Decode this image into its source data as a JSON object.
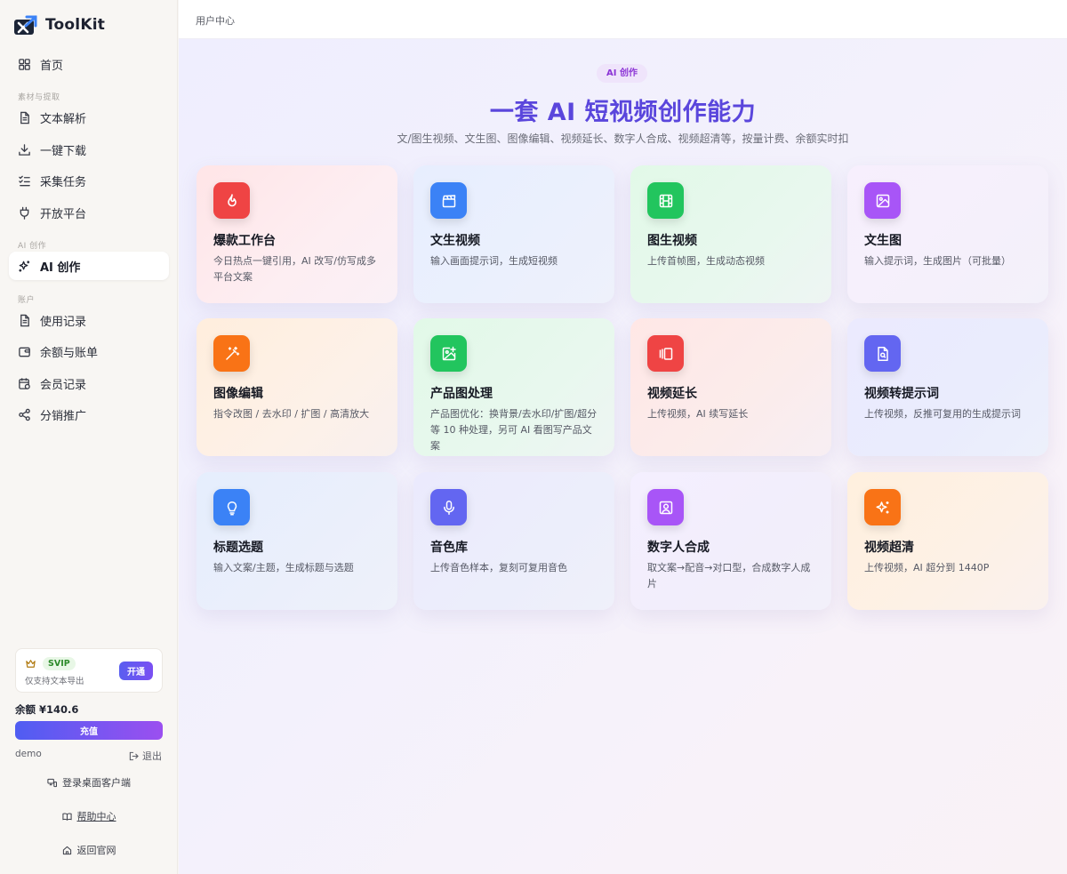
{
  "brand": {
    "name": "ToolKit"
  },
  "nav": {
    "home": "首页",
    "section_material": "素材与提取",
    "text_parse": "文本解析",
    "download": "一键下载",
    "collect": "采集任务",
    "open_platform": "开放平台",
    "section_ai": "AI 创作",
    "ai_create": "AI 创作",
    "section_account": "账户",
    "usage": "使用记录",
    "balance_bill": "余额与账单",
    "member": "会员记录",
    "affiliate": "分销推广"
  },
  "vip": {
    "badge": "SVIP",
    "desc": "仅支持文本导出",
    "button": "开通"
  },
  "account": {
    "balance": "余额 ¥140.6",
    "recharge": "充值",
    "username": "demo",
    "logout": "退出"
  },
  "footer": {
    "desktop_login": "登录桌面客户端",
    "help": "帮助中心",
    "back_home": "返回官网"
  },
  "topbar": {
    "breadcrumb": "用户中心"
  },
  "hero": {
    "tag": "AI 创作",
    "title": "一套 AI 短视频创作能力",
    "subtitle": "文/图生视频、文生图、图像编辑、视频延长、数字人合成、视频超清等，按量计费、余额实时扣"
  },
  "cards": [
    {
      "title": "爆款工作台",
      "desc": "今日热点一键引用，AI 改写/仿写成多平台文案",
      "icon": "flame-icon",
      "color": "#ef4444"
    },
    {
      "title": "文生视频",
      "desc": "输入画面提示词，生成短视频",
      "icon": "clapperboard-icon",
      "color": "#3b82f6"
    },
    {
      "title": "图生视频",
      "desc": "上传首帧图，生成动态视频",
      "icon": "film-icon",
      "color": "#22c55e"
    },
    {
      "title": "文生图",
      "desc": "输入提示词，生成图片（可批量）",
      "icon": "image-icon",
      "color": "#a855f7"
    },
    {
      "title": "图像编辑",
      "desc": "指令改图 / 去水印 / 扩图 / 高清放大",
      "icon": "magic-wand-icon",
      "color": "#f97316"
    },
    {
      "title": "产品图处理",
      "desc": "产品图优化：换背景/去水印/扩图/超分等 10 种处理，另可 AI 看图写产品文案",
      "icon": "image-plus-icon",
      "color": "#22c55e"
    },
    {
      "title": "视频延长",
      "desc": "上传视频，AI 续写延长",
      "icon": "gallery-horizontal-icon",
      "color": "#ef4444"
    },
    {
      "title": "视频转提示词",
      "desc": "上传视频，反推可复用的生成提示词",
      "icon": "file-search-icon",
      "color": "#6366f1"
    },
    {
      "title": "标题选题",
      "desc": "输入文案/主题，生成标题与选题",
      "icon": "lightbulb-icon",
      "color": "#3b82f6"
    },
    {
      "title": "音色库",
      "desc": "上传音色样本，复刻可复用音色",
      "icon": "microphone-icon",
      "color": "#6366f1"
    },
    {
      "title": "数字人合成",
      "desc": "取文案→配音→对口型，合成数字人成片",
      "icon": "user-square-icon",
      "color": "#a855f7"
    },
    {
      "title": "视频超清",
      "desc": "上传视频，AI 超分到 1440P",
      "icon": "sparkles-icon",
      "color": "#f97316"
    }
  ]
}
